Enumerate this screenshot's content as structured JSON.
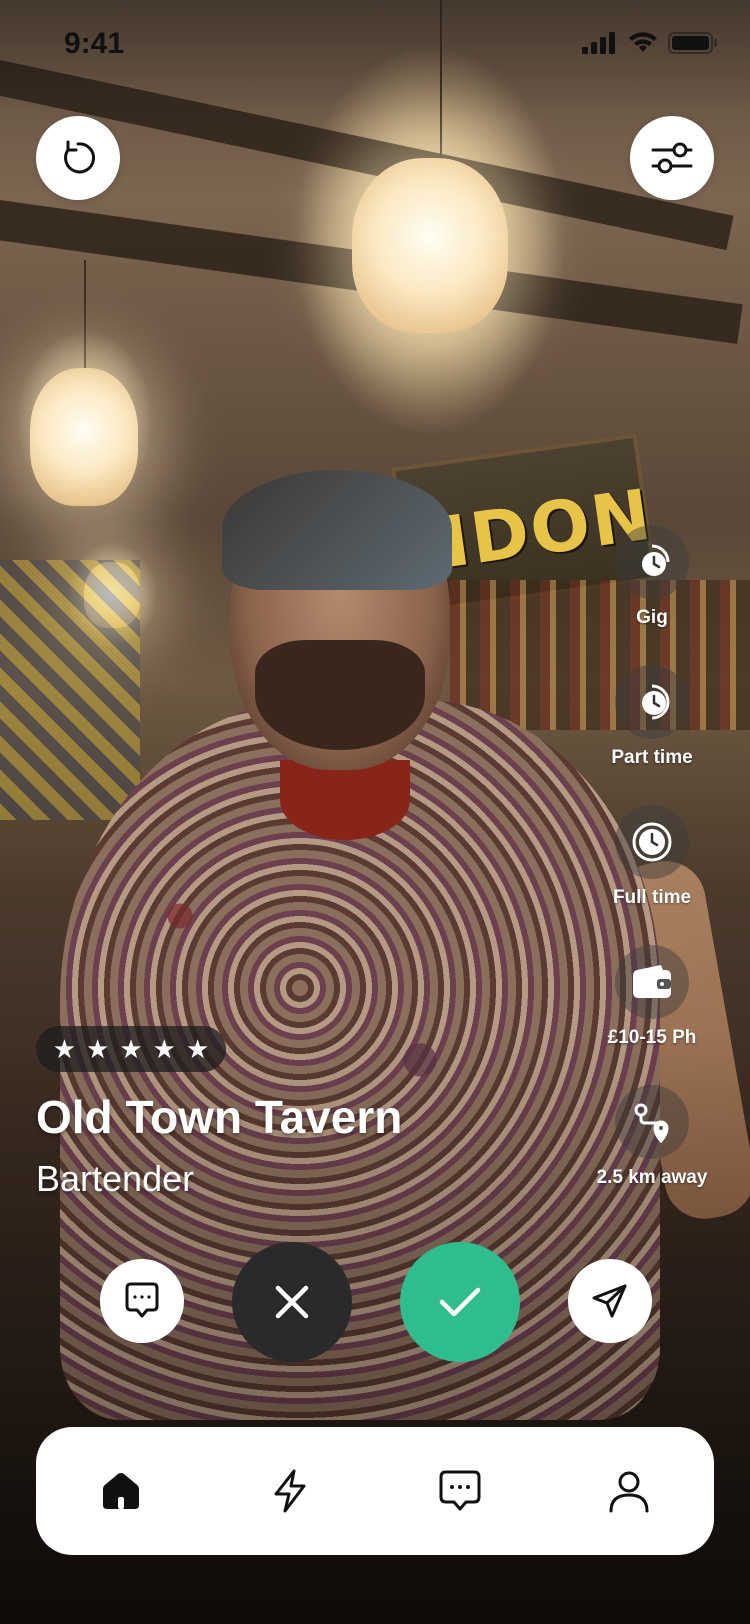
{
  "status_bar": {
    "time": "9:41"
  },
  "listing": {
    "rating_stars": 5,
    "name": "Old Town Tavern",
    "role": "Bartender"
  },
  "attributes": [
    {
      "icon": "quarter-clock-icon",
      "label": "Gig"
    },
    {
      "icon": "half-clock-icon",
      "label": "Part time"
    },
    {
      "icon": "clock-icon",
      "label": "Full time"
    },
    {
      "icon": "wallet-icon",
      "label": "£10-15 Ph"
    },
    {
      "icon": "route-icon",
      "label": "2.5 km away"
    }
  ],
  "background_sign_text": "NDON",
  "actions": {
    "message": "message-icon",
    "reject": "close-icon",
    "accept": "check-icon",
    "share": "send-icon"
  },
  "nav": [
    {
      "icon": "home-icon",
      "active": true
    },
    {
      "icon": "lightning-icon",
      "active": false
    },
    {
      "icon": "chat-icon",
      "active": false
    },
    {
      "icon": "profile-icon",
      "active": false
    }
  ],
  "colors": {
    "accept": "#2fbc8f",
    "reject": "#2a2a2a",
    "navbar": "#ffffff",
    "text_on_photo": "#ffffff"
  }
}
